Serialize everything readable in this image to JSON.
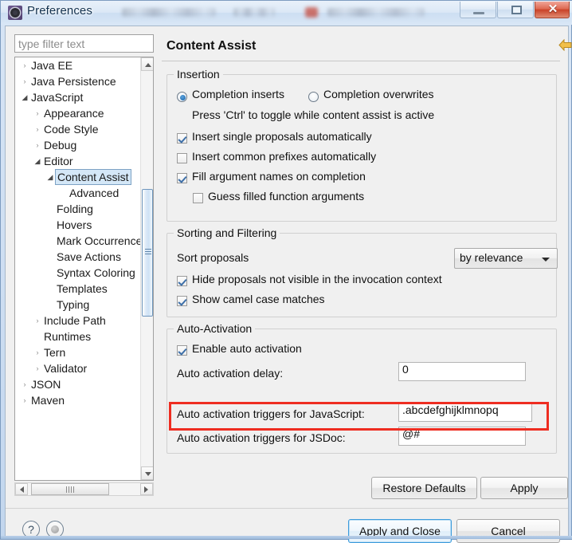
{
  "window": {
    "title": "Preferences",
    "icon": "preferences-gear-icon",
    "buttons": {
      "minimize": "minimize-icon",
      "maximize": "maximize-icon",
      "close": "✕"
    }
  },
  "filter": {
    "placeholder": "type filter text",
    "value": ""
  },
  "tree": {
    "selected": "Content Assist",
    "items": [
      {
        "label": "Java EE",
        "indent": 0,
        "arrow": "collapsed"
      },
      {
        "label": "Java Persistence",
        "indent": 0,
        "arrow": "collapsed"
      },
      {
        "label": "JavaScript",
        "indent": 0,
        "arrow": "expanded"
      },
      {
        "label": "Appearance",
        "indent": 1,
        "arrow": "collapsed"
      },
      {
        "label": "Code Style",
        "indent": 1,
        "arrow": "collapsed"
      },
      {
        "label": "Debug",
        "indent": 1,
        "arrow": "collapsed"
      },
      {
        "label": "Editor",
        "indent": 1,
        "arrow": "expanded"
      },
      {
        "label": "Content Assist",
        "indent": 2,
        "arrow": "expanded",
        "selected": true
      },
      {
        "label": "Advanced",
        "indent": 3,
        "arrow": "none"
      },
      {
        "label": "Folding",
        "indent": 2,
        "arrow": "none"
      },
      {
        "label": "Hovers",
        "indent": 2,
        "arrow": "none"
      },
      {
        "label": "Mark Occurrences",
        "indent": 2,
        "arrow": "none"
      },
      {
        "label": "Save Actions",
        "indent": 2,
        "arrow": "none"
      },
      {
        "label": "Syntax Coloring",
        "indent": 2,
        "arrow": "none"
      },
      {
        "label": "Templates",
        "indent": 2,
        "arrow": "none"
      },
      {
        "label": "Typing",
        "indent": 2,
        "arrow": "none"
      },
      {
        "label": "Include Path",
        "indent": 1,
        "arrow": "collapsed"
      },
      {
        "label": "Runtimes",
        "indent": 1,
        "arrow": "none"
      },
      {
        "label": "Tern",
        "indent": 1,
        "arrow": "collapsed"
      },
      {
        "label": "Validator",
        "indent": 1,
        "arrow": "collapsed"
      },
      {
        "label": "JSON",
        "indent": 0,
        "arrow": "collapsed"
      },
      {
        "label": "Maven",
        "indent": 0,
        "arrow": "collapsed"
      }
    ]
  },
  "pane": {
    "title": "Content Assist",
    "nav": {
      "back": "back-arrow-icon",
      "back_menu": "chevron-down-icon",
      "forward": "forward-arrow-icon",
      "forward_menu": "chevron-down-icon",
      "extra_menu": "chevron-down-icon"
    }
  },
  "insertion": {
    "legend": "Insertion",
    "radio_inserts": "Completion inserts",
    "radio_overwrites": "Completion overwrites",
    "radio_selected": "Completion inserts",
    "hint": "Press 'Ctrl' to toggle while content assist is active",
    "checks": [
      {
        "label": "Insert single proposals automatically",
        "checked": true
      },
      {
        "label": "Insert common prefixes automatically",
        "checked": false
      },
      {
        "label": "Fill argument names on completion",
        "checked": true
      },
      {
        "label": "Guess filled function arguments",
        "checked": false
      }
    ]
  },
  "sorting": {
    "legend": "Sorting and Filtering",
    "sort_label": "Sort proposals",
    "sort_value": "by relevance",
    "checks": [
      {
        "label": "Hide proposals not visible in the invocation context",
        "checked": true
      },
      {
        "label": "Show camel case matches",
        "checked": true
      }
    ]
  },
  "auto_activation": {
    "legend": "Auto-Activation",
    "enable_label": "Enable auto activation",
    "enable_checked": true,
    "delay_label": "Auto activation delay:",
    "delay_value": "0",
    "js_label": "Auto activation triggers for JavaScript:",
    "js_value": ".abcdefghijklmnopq",
    "jsdoc_label": "Auto activation triggers for JSDoc:",
    "jsdoc_value": "@#",
    "highlight_color": "#ee2d21"
  },
  "buttons": {
    "restore_defaults": "Restore Defaults",
    "apply": "Apply",
    "apply_and_close": "Apply and Close",
    "cancel": "Cancel",
    "help": "?",
    "info": "info-icon"
  },
  "colors": {
    "accent": "#3c9bdc",
    "selection": "#d4e7f7",
    "highlight": "#ee2d21",
    "nav_back": "#e8a317"
  }
}
